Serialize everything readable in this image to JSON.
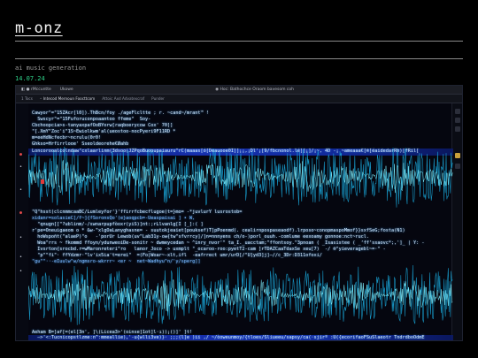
{
  "site": {
    "title": "m-onz"
  },
  "post": {
    "title": "ai music generation",
    "date": "14.07.24"
  },
  "screenshot": {
    "topbar": {
      "items": [
        "◧ ● rMccuntte",
        "Ukowe"
      ],
      "right_item": "◉ Hoc: Bathochce Oraom bavesom coh"
    },
    "tabbar": {
      "tabs": [
        "1 Tocs",
        "◦ Intecod Mernoun Foocttcom",
        "Attoic Axd Advatexcraf",
        "Punder"
      ],
      "active_index": 1
    },
    "code_lines": [
      "Cawyor\"=\"15ZAcr[l0]).ThBcn/foy ./ageFlcltte ; r. ~cand~/mrant™ !",
      "  Swscyr\"=\"15Fuforuconpoaantoo ffeme\"  Soy-",
      "Cbchoopcia>s-tanyaxpafOoBYorw[raqboerycow Cox' 70]]",
      "\"[.XmY\"Zoc'i\"1S~Ewiolkwm'al(ueostoo-nocPyeri9F11RD *",
      "m=eeHdNcfecbr~ncrulu(0r0!",
      "Ghkso=Hrfirrlooe' Sseoldeorehe€Øahb",
      "Loncorooalcolndaw\"cxlaarlinm(3dsoo(JZPqoBuooupaiauru^rC(maaas[ó[Deauooe0I]]¡¡,¡Dl'¡[9/fbcnonol.lé]]¡]/¡~, 4D -¡ ~ameaaa€[®[éaidedarRh)[fRil["
    ],
    "code_lines_mid": [
      "\"Q\"hsst(clcnmmcaaBC/Lumleyfor'}'ffirrfcbecflugoe(t=}mo= -*juvlurY lusrostob=",
      "xidanr=solasieC[/f~]{fSoronsQo'(e}aoqpcb=-Ueaspaisai ] • W,",
      "  \"qnugn[[\"?ublinm/-/swnarpupfòoxr(yiS)]nt:;rLlvanlg[I [_]:( ]",
      "r'pe=Oneuigaeom o * &w-\"xlgOaLanyghasne= - suutokjeaiet[pouksef)T]pPoenmd(. cealirnpospaseaodf).lrposo~conopmaspoMmof}}sxfSeG;fosta(N1)",
      "  hoWspoñt(\"alaeP)\"o   -'porUr Lewob(uv\"Lab31y-ow{tw\"sfvrrcy]/]n=nnnyens ch/o-)porl_ouuh.-comlume eexoamy gonnoe:nct~rucl.",
      "  Woa\"rrs ~ fkommd ffoyn/ydunweoiDe-sonitr ~ dwmeycedan ~ ^inry_nvor'\" ta_I._uacctam;\"ffontsoy.\"3pnoan ( _Isasistee ( _‘ff’ssaovc*;,']_ | Y: -",
      "  Ivsrton{srocbd.r=wMaronreteri\"ro   lanor_Joco -> uxmplt \"_ocaroo-roo:pyetT2-cam ]rTDAZCaaTdaxSe xeu[7)  -/ ®\"yieveragebl~=·\" -",
      "  \"p\"\"fi\"· ffYdzmr·\"lv'ix5ia't=erei\"  =(Fo|Woar~-xlt,ifl  -eafrrect umr/urD[/\"U]yd3]j]—//c_3Dr:D311ofoxi/",
      "\"gu\"\"··-eIuulw\"w/ngmsro-wkrrr~ <er ~  net~Wadhyu\"n/'y/sperg]]"
    ],
    "code_lines_bottom": [
      "Aeham B=]af[=(el[3n', ]\\(Licea3>'(oinse]1ot]l·ı))¡()]' ]t!",
      "  –>'<:Tucnicopstlzme:n^:mmeallie),'-u{wlli3ve)}· ;;;(l]e )ii ,/ ~/òoweunmoy/{tloes/Sliueeu/sapsy/ca(·sjirº :U({ecorifaoFSuSlaeotr TndrdboOdmE"
    ]
  }
}
